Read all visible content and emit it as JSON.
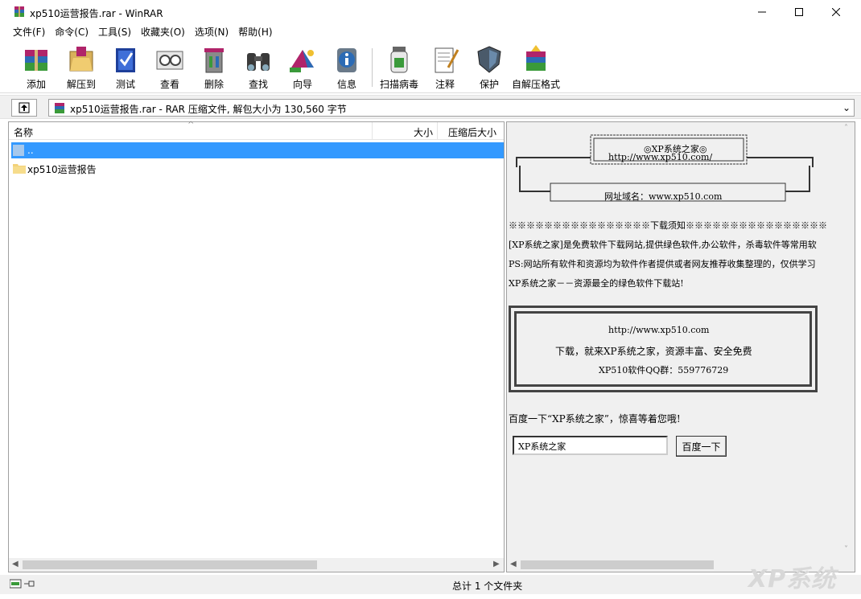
{
  "window": {
    "title": "xp510运营报告.rar - WinRAR",
    "min_glyph": "—",
    "max_glyph": "☐",
    "close_glyph": "✕"
  },
  "menu": [
    "文件(F)",
    "命令(C)",
    "工具(S)",
    "收藏夹(O)",
    "选项(N)",
    "帮助(H)"
  ],
  "toolbar": {
    "buttons": [
      {
        "label": "添加",
        "icon": "add-archive-icon"
      },
      {
        "label": "解压到",
        "icon": "extract-icon"
      },
      {
        "label": "测试",
        "icon": "test-icon"
      },
      {
        "label": "查看",
        "icon": "view-icon"
      },
      {
        "label": "删除",
        "icon": "delete-icon"
      },
      {
        "label": "查找",
        "icon": "find-icon"
      },
      {
        "label": "向导",
        "icon": "wizard-icon"
      },
      {
        "label": "信息",
        "icon": "info-icon"
      },
      {
        "label": "扫描病毒",
        "icon": "virus-scan-icon"
      },
      {
        "label": "注释",
        "icon": "comment-icon"
      },
      {
        "label": "保护",
        "icon": "protect-icon"
      },
      {
        "label": "自解压格式",
        "icon": "sfx-icon"
      }
    ]
  },
  "address": {
    "text": "xp510运营报告.rar - RAR 压缩文件, 解包大小为 130,560 字节",
    "dropdown_glyph": "⌄"
  },
  "filelist": {
    "columns": {
      "name": "名称",
      "size": "大小",
      "packed": "压缩后大小"
    },
    "rows": [
      {
        "name": "..",
        "selected": true
      },
      {
        "name": "xp510运营报告",
        "selected": false
      }
    ]
  },
  "info_panel": {
    "header_line1": "◎XP系统之家◎",
    "header_line2": "http://www.xp510.com/",
    "domain_line": "网址域名：www.xp510.com",
    "notice_title": "※※※※※※※※※※※※※※※※下载须知※※※※※※※※※※※※※※※※",
    "notice1": "[XP系统之家]是免费软件下载网站,提供绿色软件,办公软件，杀毒软件等常用软",
    "notice2": "PS:网站所有软件和资源均为软件作者提供或者网友推荐收集整理的，仅供学习",
    "notice3": "XP系统之家－－资源最全的绿色软件下载站!",
    "box_url": "http://www.xp510.com",
    "box_slogan": "下载，就来XP系统之家，资源丰富、安全免费",
    "box_qq": "XP510软件QQ群：559776729",
    "search_prompt": "百度一下“XP系统之家”，惊喜等着您哦!",
    "search_value": "XP系统之家",
    "search_button": "百度一下"
  },
  "statusbar": {
    "text": "总计 1 个文件夹"
  },
  "watermark": "XP系统"
}
